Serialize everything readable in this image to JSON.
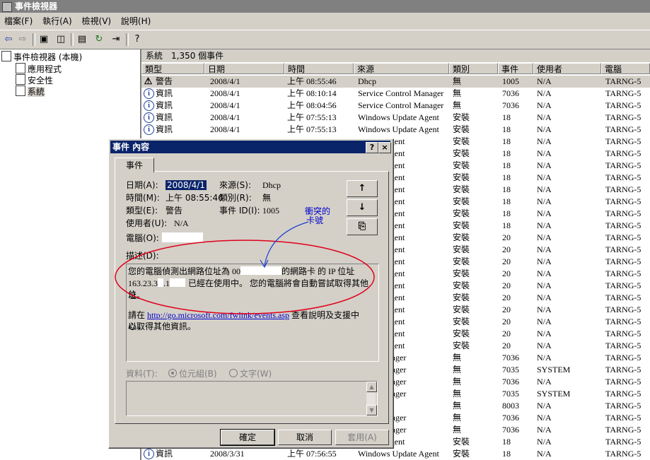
{
  "window": {
    "title": "事件檢視器"
  },
  "menu": [
    "檔案(F)",
    "執行(A)",
    "檢視(V)",
    "說明(H)"
  ],
  "tree": [
    {
      "label": "事件檢視器 (本機)",
      "icon": "event-viewer-icon"
    },
    {
      "label": "應用程式",
      "icon": "log-icon"
    },
    {
      "label": "安全性",
      "icon": "log-icon"
    },
    {
      "label": "系統",
      "icon": "log-icon"
    }
  ],
  "pane": {
    "header": "系統　1,350 個事件"
  },
  "columns": [
    "類型",
    "日期",
    "時間",
    "來源",
    "類別",
    "事件",
    "使用者",
    "電腦"
  ],
  "rows": [
    [
      "警告",
      "2008/4/1",
      "上午 08:55:46",
      "Dhcp",
      "無",
      "1005",
      "N/A",
      "TARNG-5"
    ],
    [
      "資訊",
      "2008/4/1",
      "上午 08:10:14",
      "Service Control Manager",
      "無",
      "7036",
      "N/A",
      "TARNG-5"
    ],
    [
      "資訊",
      "2008/4/1",
      "上午 08:04:56",
      "Service Control Manager",
      "無",
      "7036",
      "N/A",
      "TARNG-5"
    ],
    [
      "資訊",
      "2008/4/1",
      "上午 07:55:13",
      "Windows Update Agent",
      "安裝",
      "18",
      "N/A",
      "TARNG-5"
    ],
    [
      "資訊",
      "2008/4/1",
      "上午 07:55:13",
      "Windows Update Agent",
      "安裝",
      "18",
      "N/A",
      "TARNG-5"
    ],
    [
      "",
      "",
      "",
      "Update Agent",
      "安裝",
      "18",
      "N/A",
      "TARNG-5"
    ],
    [
      "",
      "",
      "",
      "Update Agent",
      "安裝",
      "18",
      "N/A",
      "TARNG-5"
    ],
    [
      "",
      "",
      "",
      "Update Agent",
      "安裝",
      "18",
      "N/A",
      "TARNG-5"
    ],
    [
      "",
      "",
      "",
      "Update Agent",
      "安裝",
      "18",
      "N/A",
      "TARNG-5"
    ],
    [
      "",
      "",
      "",
      "Update Agent",
      "安裝",
      "18",
      "N/A",
      "TARNG-5"
    ],
    [
      "",
      "",
      "",
      "Update Agent",
      "安裝",
      "18",
      "N/A",
      "TARNG-5"
    ],
    [
      "",
      "",
      "",
      "Update Agent",
      "安裝",
      "18",
      "N/A",
      "TARNG-5"
    ],
    [
      "",
      "",
      "",
      "Update Agent",
      "安裝",
      "18",
      "N/A",
      "TARNG-5"
    ],
    [
      "",
      "",
      "",
      "Update Agent",
      "安裝",
      "20",
      "N/A",
      "TARNG-5"
    ],
    [
      "",
      "",
      "",
      "Update Agent",
      "安裝",
      "20",
      "N/A",
      "TARNG-5"
    ],
    [
      "",
      "",
      "",
      "Update Agent",
      "安裝",
      "20",
      "N/A",
      "TARNG-5"
    ],
    [
      "",
      "",
      "",
      "Update Agent",
      "安裝",
      "20",
      "N/A",
      "TARNG-5"
    ],
    [
      "",
      "",
      "",
      "Update Agent",
      "安裝",
      "20",
      "N/A",
      "TARNG-5"
    ],
    [
      "",
      "",
      "",
      "Update Agent",
      "安裝",
      "20",
      "N/A",
      "TARNG-5"
    ],
    [
      "",
      "",
      "",
      "Update Agent",
      "安裝",
      "20",
      "N/A",
      "TARNG-5"
    ],
    [
      "",
      "",
      "",
      "Update Agent",
      "安裝",
      "20",
      "N/A",
      "TARNG-5"
    ],
    [
      "",
      "",
      "",
      "Update Agent",
      "安裝",
      "20",
      "N/A",
      "TARNG-5"
    ],
    [
      "",
      "",
      "",
      "Update Agent",
      "安裝",
      "20",
      "N/A",
      "TARNG-5"
    ],
    [
      "",
      "",
      "",
      "ntrol Manager",
      "無",
      "7036",
      "N/A",
      "TARNG-5"
    ],
    [
      "",
      "",
      "",
      "ntrol Manager",
      "無",
      "7035",
      "SYSTEM",
      "TARNG-5"
    ],
    [
      "",
      "",
      "",
      "ntrol Manager",
      "無",
      "7036",
      "N/A",
      "TARNG-5"
    ],
    [
      "",
      "",
      "",
      "ntrol Manager",
      "無",
      "7035",
      "SYSTEM",
      "TARNG-5"
    ],
    [
      "",
      "",
      "",
      "",
      "無",
      "8003",
      "N/A",
      "TARNG-5"
    ],
    [
      "",
      "",
      "",
      "ntrol Manager",
      "無",
      "7036",
      "N/A",
      "TARNG-5"
    ],
    [
      "",
      "",
      "",
      "ntrol Manager",
      "無",
      "7036",
      "N/A",
      "TARNG-5"
    ],
    [
      "",
      "",
      "",
      "Update Agent",
      "安裝",
      "18",
      "N/A",
      "TARNG-5"
    ],
    [
      "資訊",
      "2008/3/31",
      "上午 07:56:55",
      "Windows Update Agent",
      "安裝",
      "18",
      "N/A",
      "TARNG-5"
    ]
  ],
  "dialog": {
    "title": "事件 內容",
    "help": "?",
    "close": "×",
    "tab": "事件",
    "date_label": "日期(A):",
    "date_value": "2008/4/1",
    "source_label": "來源(S):",
    "source_value": "Dhcp",
    "time_label": "時間(M):",
    "time_value": "上午 08:55:46",
    "category_label": "類別(R):",
    "category_value": "無",
    "type_label": "類型(E):",
    "type_value": "警告",
    "eventid_label": "事件 ID(I):",
    "eventid_value": "1005",
    "user_label": "使用者(U):",
    "user_value": "N/A",
    "computer_label": "電腦(O):",
    "up": "↑",
    "down": "↓",
    "copy": "⎘",
    "desc_label": "描述(D):",
    "desc_line1a": "您的電腦偵測出網路位址為 00",
    "desc_line1b": "的網路卡 的 IP 位址",
    "desc_line2a": "163.23.3",
    "desc_line2b": ".1",
    "desc_line2c": "已經在使用中。 您的電腦將會自動嘗試取得其他位",
    "desc_line3": "址。",
    "desc_line4a": "請在 ",
    "desc_link": "http://go.microsoft.com/fwlink/events.asp",
    "desc_line4b": " 查看說明及支援中心，",
    "desc_line5": "以取得其他資訊。",
    "data_label": "資料(T):",
    "radio_bytes": "位元組(B)",
    "radio_words": "文字(W)",
    "ok": "確定",
    "cancel": "取消",
    "apply": "套用(A)"
  },
  "annotation": {
    "line1": "衝突的",
    "line2": "卡號"
  }
}
